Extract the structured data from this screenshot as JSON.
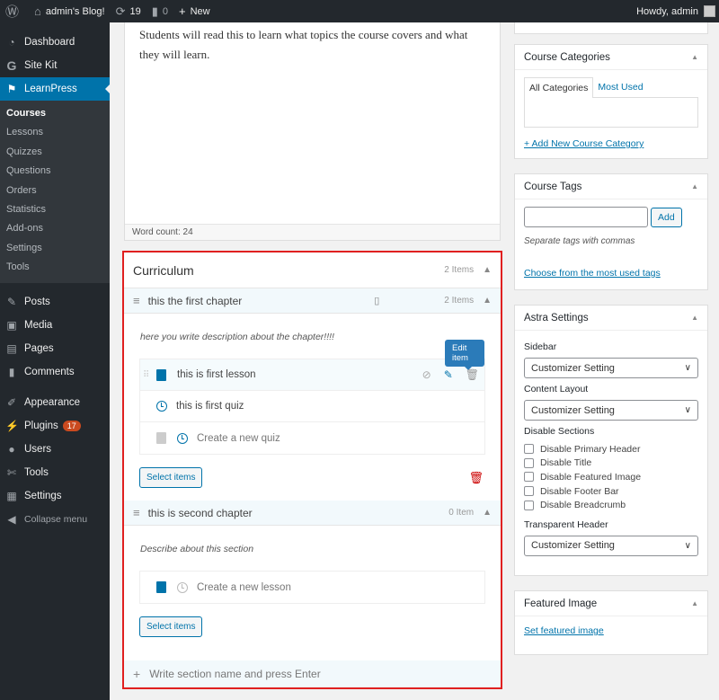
{
  "adminbar": {
    "site_name": "admin's Blog!",
    "updates": "19",
    "comments": "0",
    "new_label": "New",
    "greeting": "Howdy, admin"
  },
  "sidebar": {
    "top": [
      {
        "label": "Dashboard",
        "icon": "dashboard-icon"
      },
      {
        "label": "Site Kit",
        "icon": "google-g-icon"
      },
      {
        "label": "LearnPress",
        "icon": "graduation-cap-icon"
      }
    ],
    "submenu": [
      "Courses",
      "Lessons",
      "Quizzes",
      "Questions",
      "Orders",
      "Statistics",
      "Add-ons",
      "Settings",
      "Tools"
    ],
    "group2": [
      {
        "label": "Posts",
        "icon": "pin-icon"
      },
      {
        "label": "Media",
        "icon": "media-icon"
      },
      {
        "label": "Pages",
        "icon": "pages-icon"
      },
      {
        "label": "Comments",
        "icon": "comment-icon"
      }
    ],
    "group3": [
      {
        "label": "Appearance",
        "icon": "brush-icon"
      },
      {
        "label": "Plugins",
        "icon": "plugin-icon",
        "badge": "17"
      },
      {
        "label": "Users",
        "icon": "user-icon"
      },
      {
        "label": "Tools",
        "icon": "wrench-icon"
      },
      {
        "label": "Settings",
        "icon": "settings-icon"
      },
      {
        "label": "Collapse menu",
        "icon": "collapse-icon"
      }
    ]
  },
  "editor": {
    "text": "Students will read this to learn what topics the course covers and what they will learn.",
    "word_count": "Word count: 24"
  },
  "curriculum": {
    "title": "Curriculum",
    "count": "2 Items",
    "sections": [
      {
        "name": "this the first chapter",
        "count": "2 Items",
        "description": "here you write description about the chapter!!!!",
        "items": [
          {
            "title": "this is first lesson",
            "type": "lesson"
          },
          {
            "title": "this is first quiz",
            "type": "quiz"
          }
        ],
        "new_item_placeholder": "Create a new quiz",
        "tooltip": "Edit item",
        "select_label": "Select items"
      },
      {
        "name": "this is second chapter",
        "count": "0 Item",
        "description": "Describe about this section",
        "new_item_placeholder": "Create a new lesson",
        "select_label": "Select items"
      }
    ],
    "add_section_placeholder": "Write section name and press Enter"
  },
  "categories": {
    "title": "Course Categories",
    "tab_all": "All Categories",
    "tab_used": "Most Used",
    "add_link": "+ Add New Course Category"
  },
  "tags": {
    "title": "Course Tags",
    "add_label": "Add",
    "hint": "Separate tags with commas",
    "choose_link": "Choose from the most used tags"
  },
  "astra": {
    "title": "Astra Settings",
    "sidebar_label": "Sidebar",
    "sidebar_value": "Customizer Setting",
    "layout_label": "Content Layout",
    "layout_value": "Customizer Setting",
    "disable_label": "Disable Sections",
    "checkboxes": [
      "Disable Primary Header",
      "Disable Title",
      "Disable Featured Image",
      "Disable Footer Bar",
      "Disable Breadcrumb"
    ],
    "transparent_label": "Transparent Header",
    "transparent_value": "Customizer Setting"
  },
  "featured": {
    "title": "Featured Image",
    "link": "Set featured image"
  }
}
